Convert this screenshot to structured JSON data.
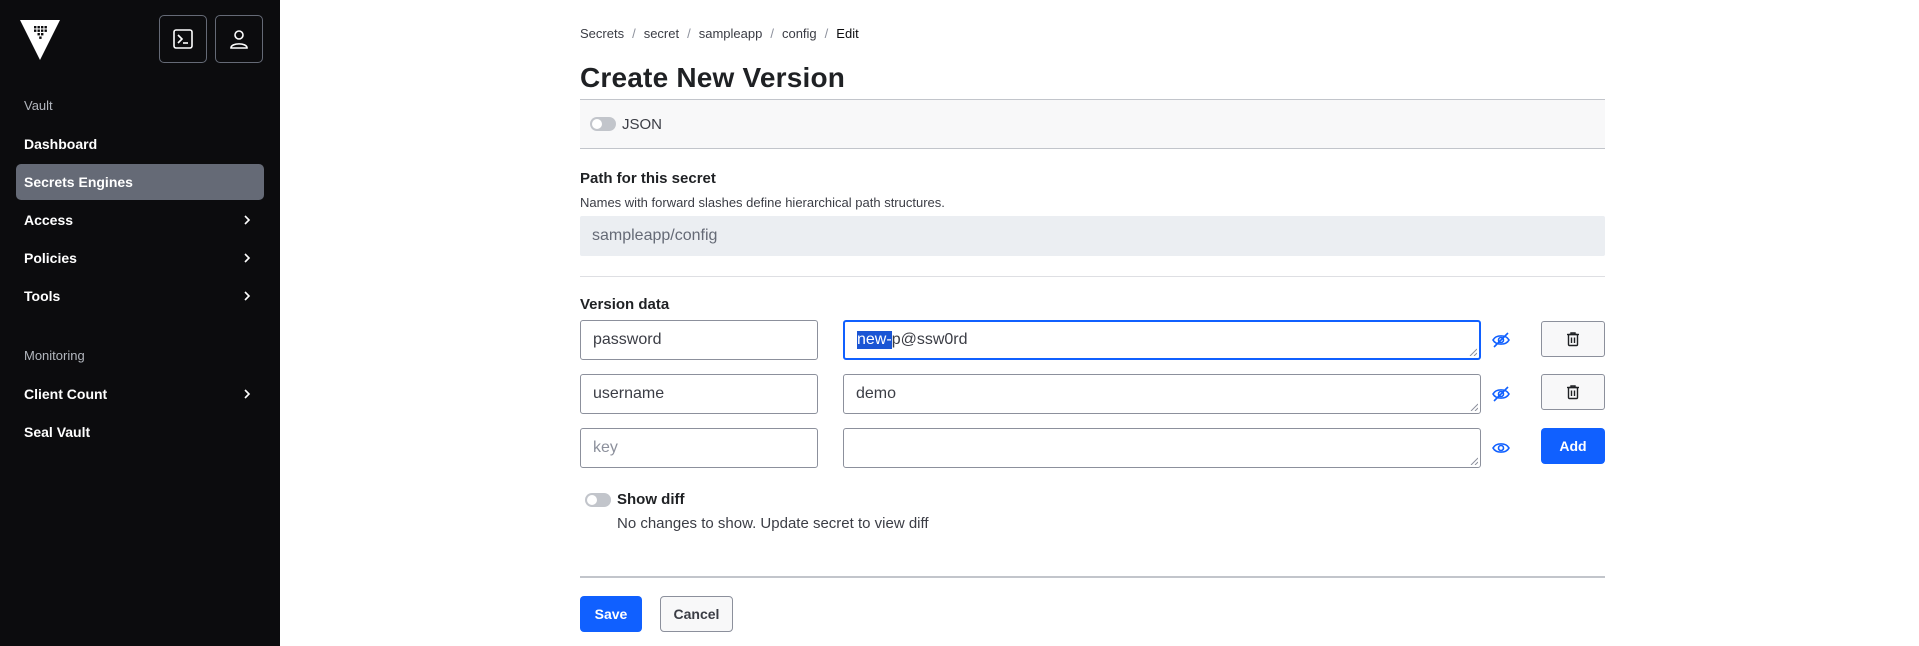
{
  "sidebar": {
    "sections": [
      {
        "label": "Vault"
      },
      {
        "label": "Monitoring"
      }
    ],
    "items": [
      {
        "label": "Dashboard"
      },
      {
        "label": "Secrets Engines"
      },
      {
        "label": "Access"
      },
      {
        "label": "Policies"
      },
      {
        "label": "Tools"
      },
      {
        "label": "Client Count"
      },
      {
        "label": "Seal Vault"
      }
    ],
    "active_item": "Secrets Engines"
  },
  "breadcrumb": [
    "Secrets",
    "secret",
    "sampleapp",
    "config",
    "Edit"
  ],
  "page": {
    "title": "Create New Version",
    "json_toggle_label": "JSON"
  },
  "path": {
    "label": "Path for this secret",
    "helper": "Names with forward slashes define hierarchical path structures.",
    "value": "sampleapp/config"
  },
  "version_data": {
    "label": "Version data",
    "rows": [
      {
        "key": "password",
        "value_selected": "new-",
        "value_rest": "p@ssw0rd"
      },
      {
        "key": "username",
        "value": "demo"
      },
      {
        "key_placeholder": "key",
        "value": ""
      }
    ],
    "add_label": "Add"
  },
  "diff": {
    "label": "Show diff",
    "note": "No changes to show. Update secret to view diff"
  },
  "actions": {
    "save": "Save",
    "cancel": "Cancel"
  },
  "colors": {
    "sidebar_bg": "#0c0c0e",
    "active_item_bg": "#656a76",
    "primary": "#1060ff",
    "selection": "#1a55d4"
  }
}
